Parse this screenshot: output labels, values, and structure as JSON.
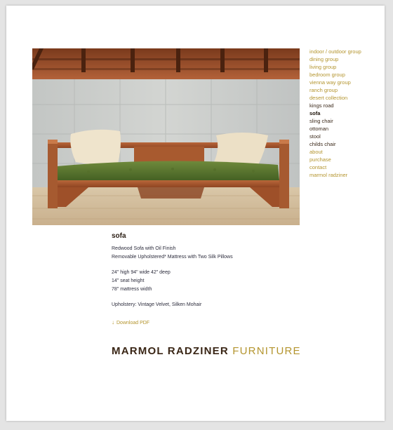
{
  "product": {
    "name": "sofa",
    "details": [
      "Redwood Sofa with Oil Finish",
      "Removable Upholstered* Mattress with Two Silk Pillows"
    ],
    "dimensions": [
      "24\" high 94\" wide 42\" deep",
      "14\" seat height",
      "78\" mattress width"
    ],
    "upholstery": "Upholstery: Vintage Velvet, Silken Mohair",
    "download_label": "Download PDF"
  },
  "nav": {
    "items": [
      {
        "label": "indoor / outdoor group",
        "state": "link"
      },
      {
        "label": "dining group",
        "state": "link"
      },
      {
        "label": "living group",
        "state": "link"
      },
      {
        "label": "bedroom group",
        "state": "link"
      },
      {
        "label": "vienna way group",
        "state": "link"
      },
      {
        "label": "ranch group",
        "state": "link"
      },
      {
        "label": "desert collection",
        "state": "link"
      },
      {
        "label": "kings road",
        "state": "current-section"
      },
      {
        "label": "sofa",
        "state": "active"
      },
      {
        "label": "sling chair",
        "state": "current-section"
      },
      {
        "label": "ottoman",
        "state": "current-section"
      },
      {
        "label": "stool",
        "state": "current-section"
      },
      {
        "label": "childs chair",
        "state": "current-section"
      },
      {
        "label": "about",
        "state": "link"
      },
      {
        "label": "purchase",
        "state": "link"
      },
      {
        "label": "contact",
        "state": "link"
      },
      {
        "label": "marmol radziner",
        "state": "link"
      }
    ]
  },
  "brand": {
    "part1": "MARMOL RADZINER",
    "part2": "FURNITURE"
  },
  "icons": {
    "download": "down-arrow-icon"
  },
  "colors": {
    "accent_gold": "#b4952f",
    "dark_brown": "#3a2616",
    "background": "#e4e4e4",
    "page": "#ffffff"
  }
}
